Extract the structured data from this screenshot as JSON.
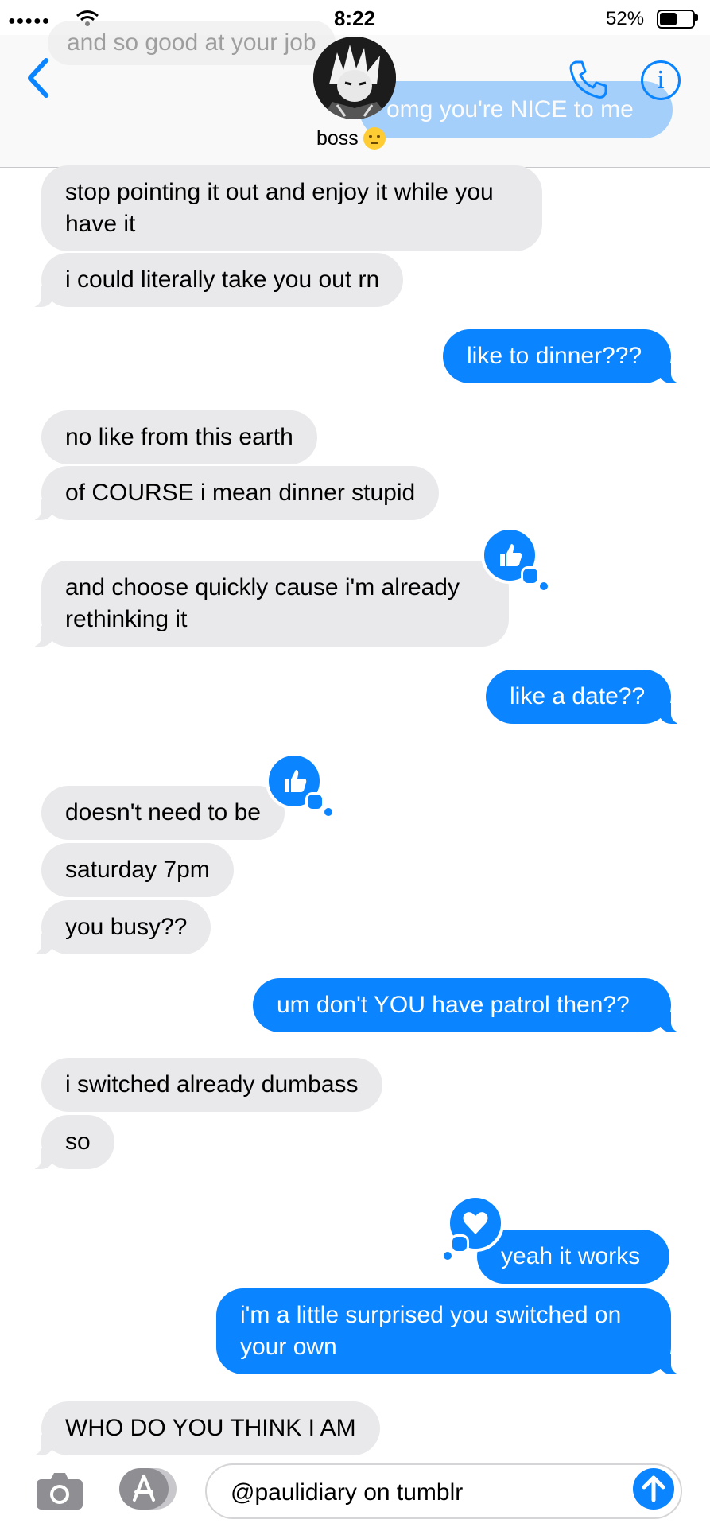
{
  "status_bar": {
    "time": "8:22",
    "battery": "52%",
    "battery_level": 0.52
  },
  "header": {
    "contact_name": "boss",
    "contact_emoji": "flushed-face-emoji",
    "ghost_incoming": "and so good at your job",
    "ghost_outgoing": "omg you're NICE to me",
    "icons": [
      "back-chevron-icon",
      "phone-icon",
      "info-icon"
    ]
  },
  "messages": [
    {
      "from": "them",
      "text": "stop pointing it out and enjoy it while you have it"
    },
    {
      "from": "them",
      "text": "i could literally take you out rn"
    },
    {
      "from": "me",
      "text": "like to dinner???"
    },
    {
      "from": "them",
      "text": "no like from this earth"
    },
    {
      "from": "them",
      "text": "of COURSE i mean dinner stupid"
    },
    {
      "from": "them",
      "text": "and choose quickly cause i'm already rethinking it",
      "tapback": "thumbs-up"
    },
    {
      "from": "me",
      "text": "like a date??"
    },
    {
      "from": "them",
      "text": "doesn't need to be",
      "tapback": "thumbs-up"
    },
    {
      "from": "them",
      "text": "saturday 7pm"
    },
    {
      "from": "them",
      "text": "you busy??"
    },
    {
      "from": "me",
      "text": "um don't YOU have patrol then??"
    },
    {
      "from": "them",
      "text": "i switched already dumbass"
    },
    {
      "from": "them",
      "text": "so"
    },
    {
      "from": "me",
      "text": "yeah it works",
      "tapback": "heart"
    },
    {
      "from": "me",
      "text": "i'm a little surprised you switched on your own"
    },
    {
      "from": "them",
      "text": "WHO DO YOU THINK I AM"
    }
  ],
  "input_bar": {
    "text": "@paulidiary on tumblr"
  },
  "colors": {
    "outgoing": "#0a84ff",
    "incoming": "#e9e9eb",
    "accent": "#0a84ff"
  }
}
